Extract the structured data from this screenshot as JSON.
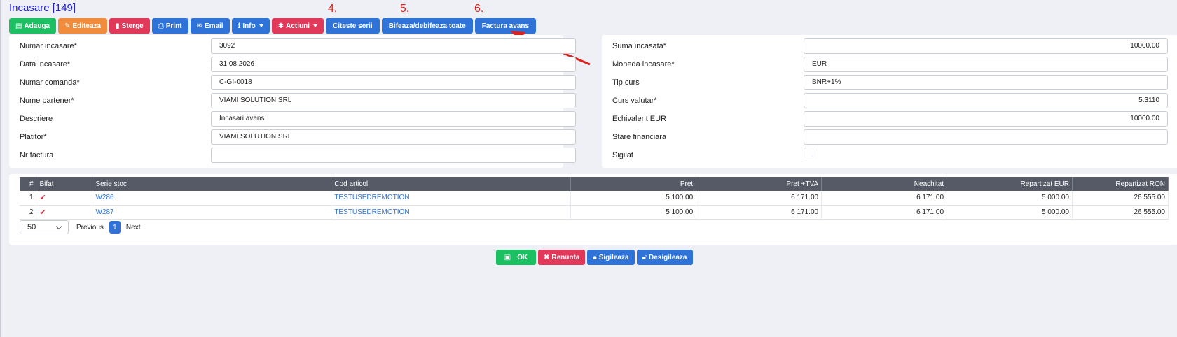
{
  "title": "Incasare [149]",
  "toolbar": {
    "adauga": "Adauga",
    "editeaza": "Editeaza",
    "sterge": "Sterge",
    "print": "Print",
    "email": "Email",
    "info": "Info",
    "actiuni": "Actiuni",
    "citeste_serii": "Citeste serii",
    "bifeaza": "Bifeaza/debifeaza toate",
    "factura_avans": "Factura avans"
  },
  "annotations": {
    "step4": "4.",
    "step5": "5.",
    "step6": "6."
  },
  "left_form": [
    {
      "label": "Numar incasare*",
      "value": "3092"
    },
    {
      "label": "Data incasare*",
      "value": "31.08.2026"
    },
    {
      "label": "Numar comanda*",
      "value": "C-GI-0018"
    },
    {
      "label": "Nume partener*",
      "value": "VIAMI SOLUTION SRL"
    },
    {
      "label": "Descriere",
      "value": "Incasari avans"
    },
    {
      "label": "Platitor*",
      "value": "VIAMI SOLUTION SRL"
    },
    {
      "label": "Nr factura",
      "value": ""
    }
  ],
  "right_form": [
    {
      "label": "Suma incasata*",
      "value": "10000.00"
    },
    {
      "label": "Moneda incasare*",
      "value": "EUR"
    },
    {
      "label": "Tip curs",
      "value": "BNR+1%"
    },
    {
      "label": "Curs valutar*",
      "value": "5.3110"
    },
    {
      "label": "Echivalent EUR",
      "value": "10000.00"
    },
    {
      "label": "Stare financiara",
      "value": ""
    },
    {
      "label": "Sigilat",
      "value": ""
    }
  ],
  "table": {
    "headers": [
      "#",
      "Bifat",
      "Serie stoc",
      "Cod articol",
      "Pret",
      "Pret +TVA",
      "Neachitat",
      "Repartizat EUR",
      "Repartizat RON"
    ],
    "rows": [
      [
        "1",
        "",
        "W286",
        "TESTUSEDREMOTION",
        "5 100.00",
        "6 171.00",
        "6 171.00",
        "5 000.00",
        "26 555.00"
      ],
      [
        "2",
        "",
        "W287",
        "TESTUSEDREMOTION",
        "5 100.00",
        "6 171.00",
        "6 171.00",
        "5 000.00",
        "26 555.00"
      ]
    ]
  },
  "pager": {
    "page_size": "50",
    "previous": "Previous",
    "page": "1",
    "next": "Next"
  },
  "bottom": {
    "ok": "OK",
    "renunta": "Renunta",
    "sigileaza": "Sigileaza",
    "desigileaza": "Desigileaza"
  },
  "colors": {
    "green": "#1dbf63",
    "orange": "#f08c3b",
    "red": "#e0395a",
    "blue": "#2f73d9",
    "annotation": "#e0201a"
  }
}
